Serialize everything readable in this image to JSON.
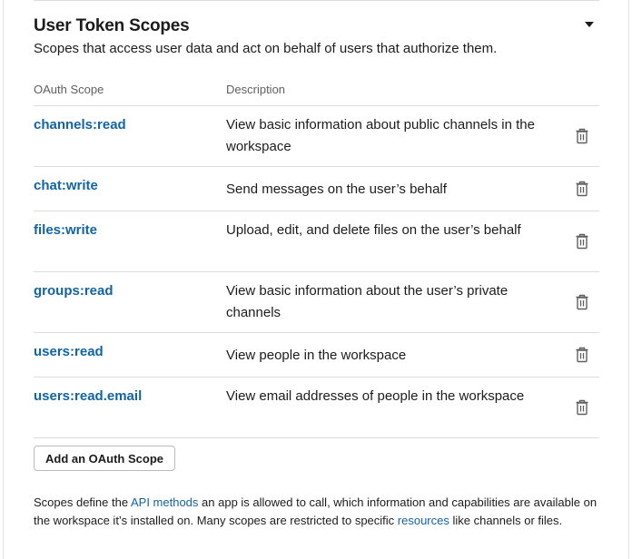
{
  "section": {
    "title": "User Token Scopes",
    "subtitle": "Scopes that access user data and act on behalf of users that authorize them.",
    "collapse_icon": "caret-down-icon"
  },
  "table": {
    "headers": {
      "scope": "OAuth Scope",
      "description": "Description"
    },
    "rows": [
      {
        "scope": "channels:read",
        "description": "View basic information about public channels in the workspace",
        "icon": "trash-icon"
      },
      {
        "scope": "chat:write",
        "description": "Send messages on the user’s behalf",
        "icon": "trash-icon"
      },
      {
        "scope": "files:write",
        "description": "Upload, edit, and delete files on the user’s behalf",
        "icon": "trash-icon"
      },
      {
        "scope": "groups:read",
        "description": "View basic information about the user’s private channels",
        "icon": "trash-icon"
      },
      {
        "scope": "users:read",
        "description": "View people in the workspace",
        "icon": "trash-icon"
      },
      {
        "scope": "users:read.email",
        "description": "View email addresses of people in the workspace",
        "icon": "trash-icon"
      }
    ]
  },
  "add_button_label": "Add an OAuth Scope",
  "footer": {
    "text_1": "Scopes define the ",
    "link_1": "API methods",
    "text_2": " an app is allowed to call, which information and capabilities are available on the workspace it’s installed on. Many scopes are restricted to specific ",
    "link_2": "resources",
    "text_3": " like channels or files."
  },
  "colors": {
    "link": "#1264a3",
    "text": "#1d1c1d",
    "muted": "#616061",
    "divider": "#dddddd"
  }
}
